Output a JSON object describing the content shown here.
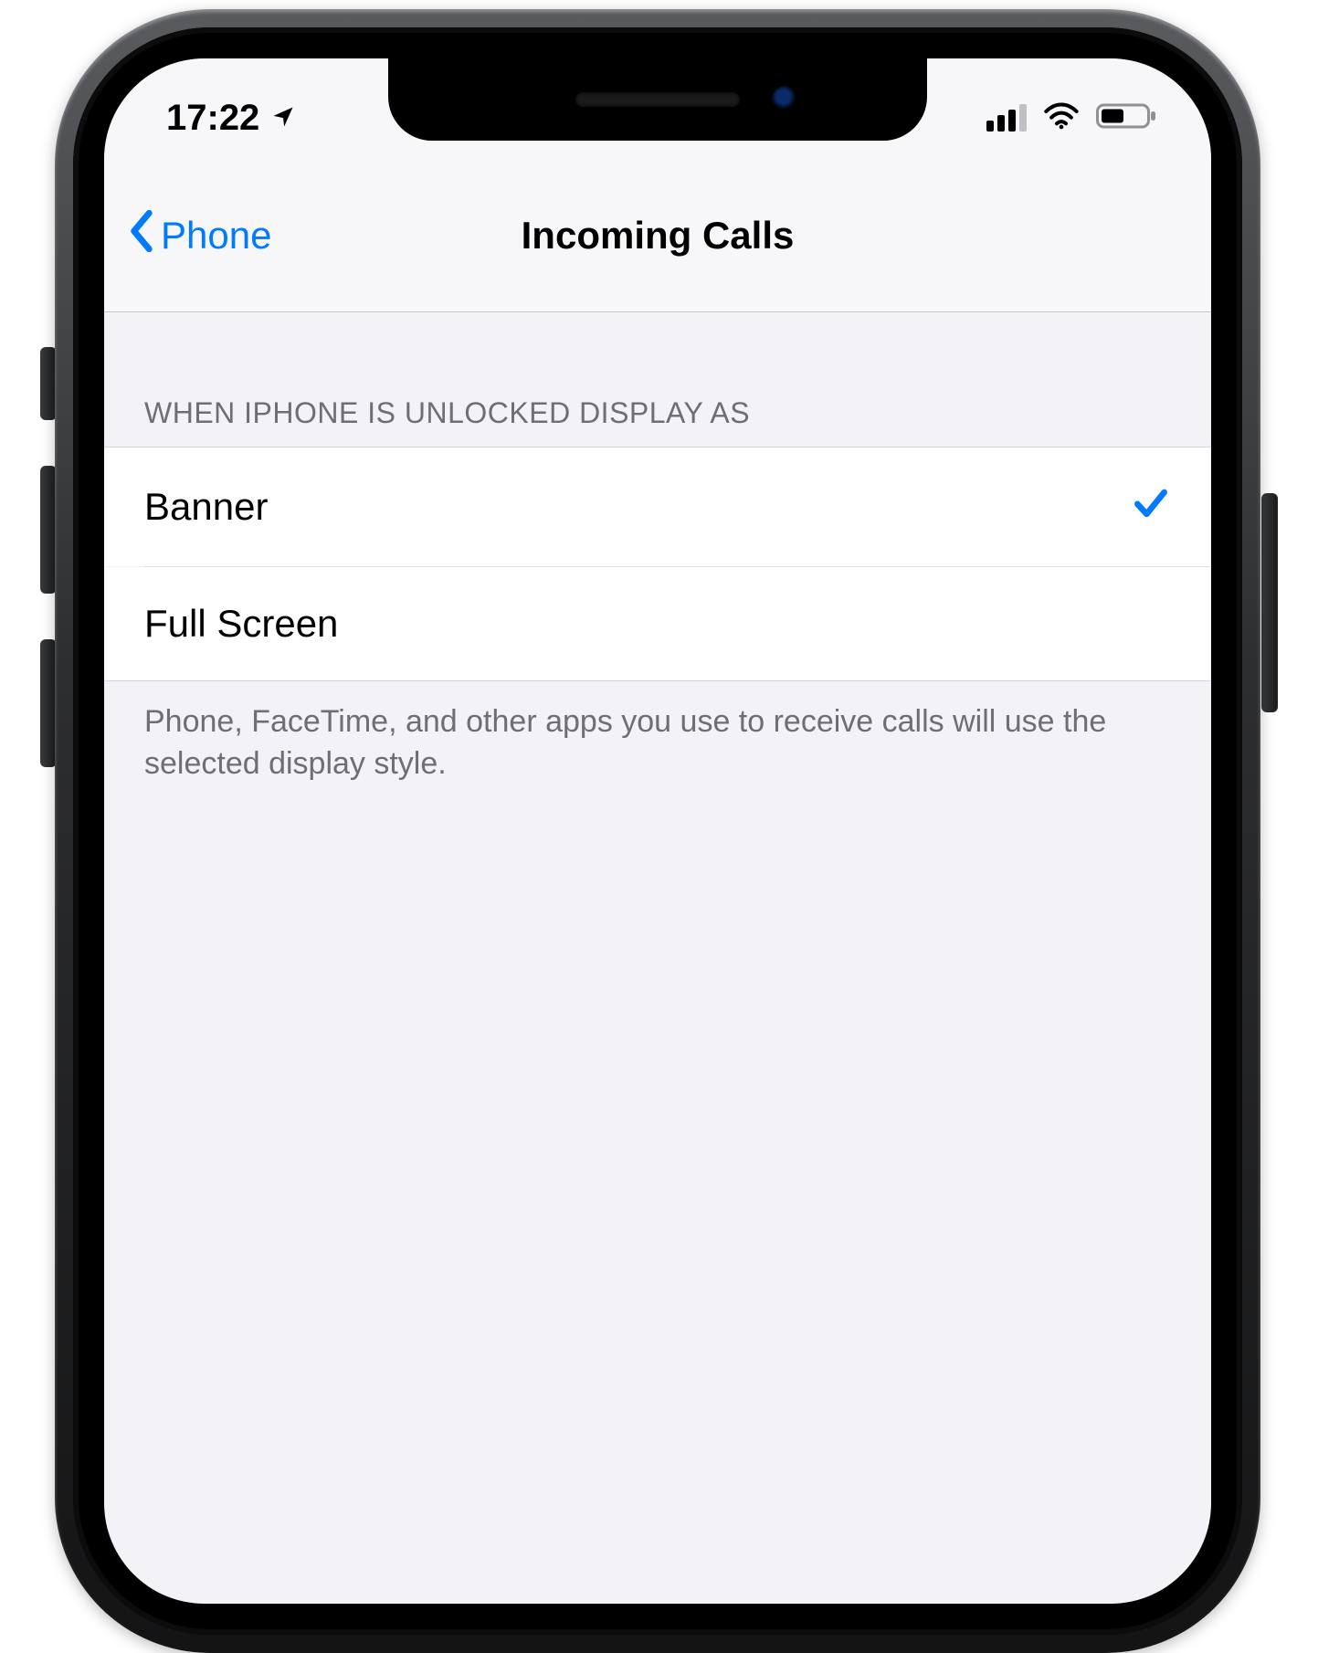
{
  "status_bar": {
    "time": "17:22",
    "location_icon": "location-arrow",
    "cellular_bars_active": 3,
    "cellular_bars_total": 4,
    "wifi_icon": "wifi",
    "battery_icon": "battery-half"
  },
  "nav": {
    "back_label": "Phone",
    "title": "Incoming Calls"
  },
  "section": {
    "header": "WHEN IPHONE IS UNLOCKED DISPLAY AS",
    "footer": "Phone, FaceTime, and other apps you use to receive calls will use the selected display style.",
    "options": [
      {
        "label": "Banner",
        "selected": true
      },
      {
        "label": "Full Screen",
        "selected": false
      }
    ]
  },
  "colors": {
    "tint": "#007aff",
    "grouped_bg": "#f2f2f7",
    "cell_bg": "#ffffff",
    "secondary_label": "#6e6e73"
  }
}
